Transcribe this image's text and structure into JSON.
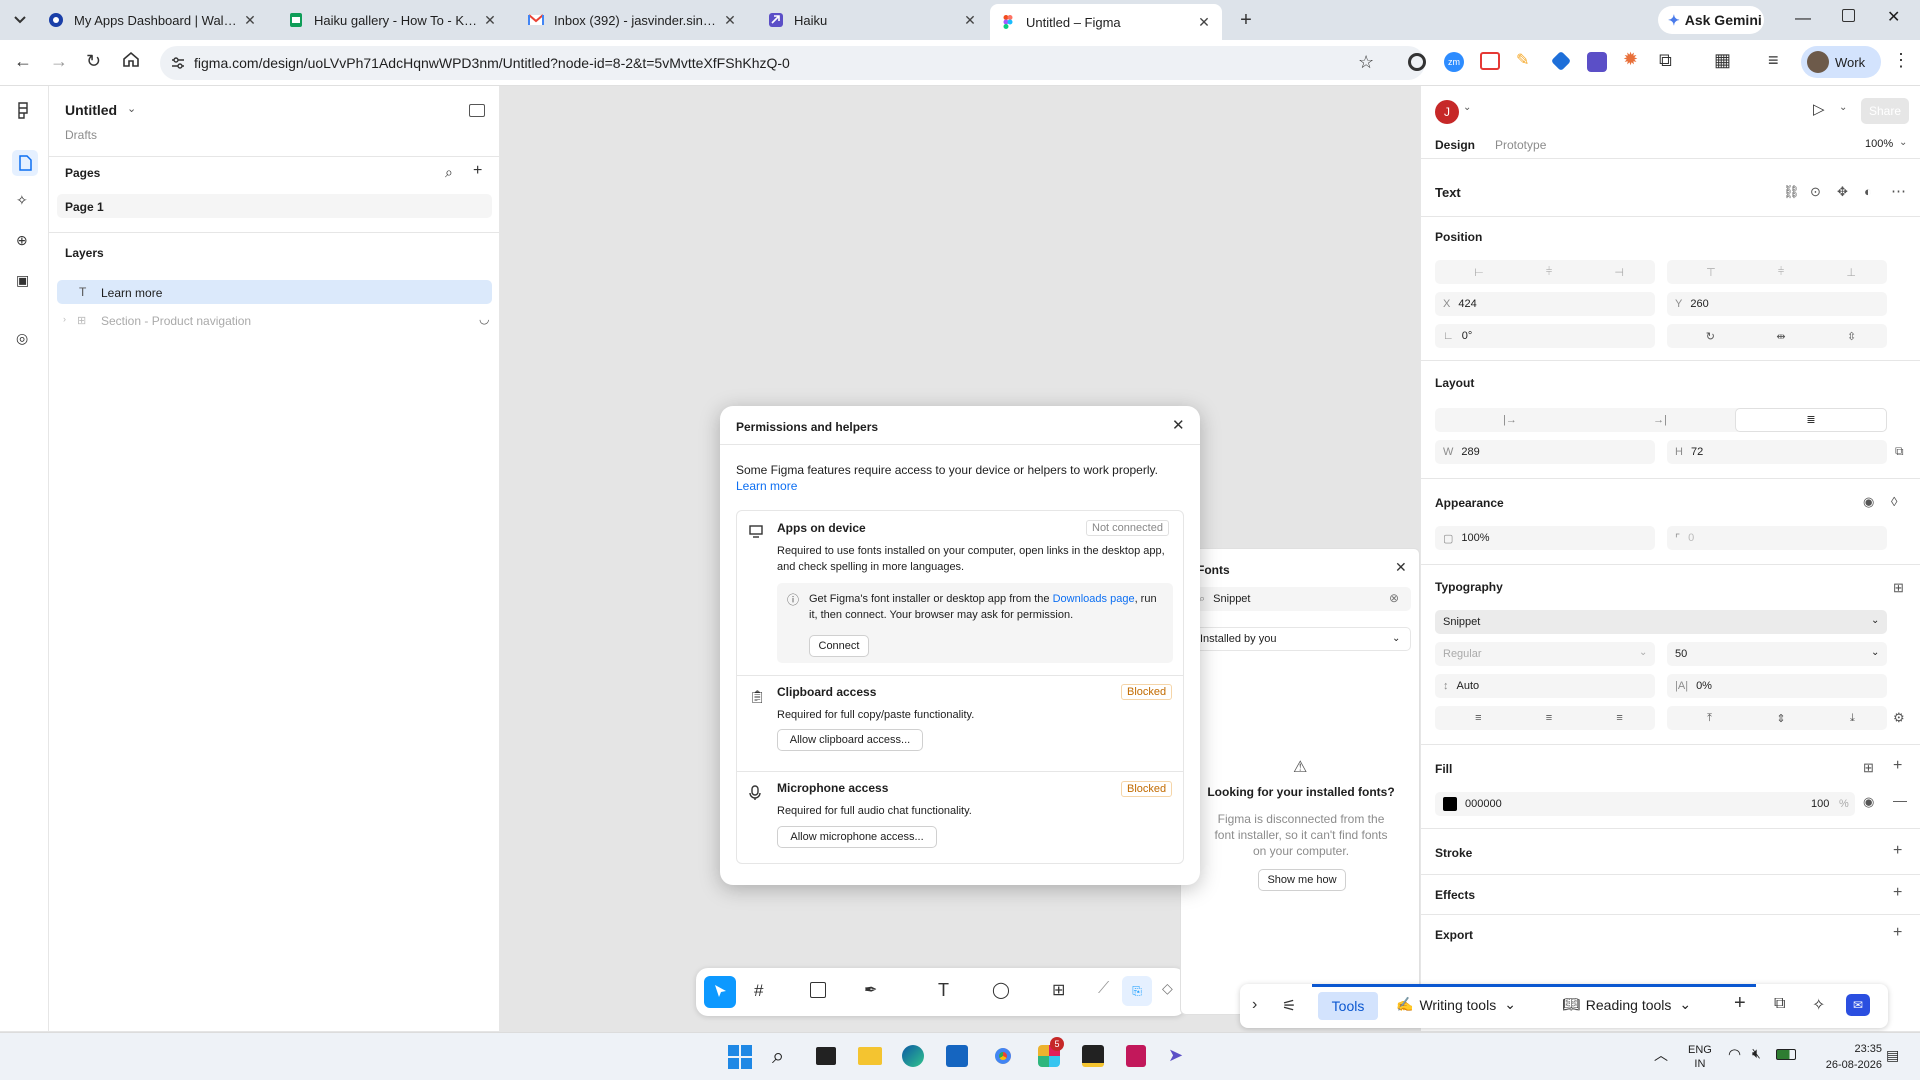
{
  "browser": {
    "tabs": [
      {
        "title": "My Apps Dashboard | WalkMe",
        "icon": "walkme-icon"
      },
      {
        "title": "Haiku gallery - How To - Keywo",
        "icon": "sheets-icon"
      },
      {
        "title": "Inbox (392) - jasvinder.singh@v",
        "icon": "gmail-icon"
      },
      {
        "title": "Haiku",
        "icon": "haiku-icon"
      },
      {
        "title": "Untitled – Figma",
        "icon": "figma-icon"
      }
    ],
    "ask_gemini": "Ask Gemini",
    "url": "figma.com/design/uoLVvPh71AdcHqnwWPD3nm/Untitled?node-id=8-2&t=5vMvtteXfFShKhzQ-0",
    "profile": "Work"
  },
  "left_panel": {
    "file_name": "Untitled",
    "location": "Drafts",
    "pages_heading": "Pages",
    "pages": [
      "Page 1"
    ],
    "layers_heading": "Layers",
    "layers": [
      "Learn more",
      "Section - Product navigation"
    ]
  },
  "right_panel": {
    "avatar": "J",
    "share": "Share",
    "tabs": [
      "Design",
      "Prototype"
    ],
    "zoom": "100%",
    "selection_type": "Text",
    "position_heading": "Position",
    "x_label": "X",
    "x": "424",
    "y_label": "Y",
    "y": "260",
    "rotation": "0°",
    "layout_heading": "Layout",
    "w_label": "W",
    "w": "289",
    "h_label": "H",
    "h": "72",
    "appearance_heading": "Appearance",
    "opacity": "100%",
    "radius": "0",
    "typography_heading": "Typography",
    "font": "Snippet",
    "weight": "Regular",
    "size": "50",
    "line_height": "Auto",
    "letter_spacing": "0%",
    "fill_heading": "Fill",
    "fill_hex": "000000",
    "fill_opacity": "100",
    "fill_pct": "%",
    "fill_color": "#000000",
    "stroke_heading": "Stroke",
    "effects_heading": "Effects",
    "export_heading": "Export"
  },
  "dialog": {
    "title": "Permissions and helpers",
    "intro": "Some Figma features require access to your device or helpers to work properly.",
    "learn_more": "Learn more",
    "apps": {
      "title": "Apps on device",
      "status": "Not connected",
      "desc": "Required to use fonts installed on your computer, open links in the desktop app, and check spelling in more languages.",
      "info_pre": "Get Figma's font installer or desktop app from the ",
      "info_link": "Downloads page",
      "info_post": ", run it, then connect. Your browser may ask for permission.",
      "button": "Connect"
    },
    "clipboard": {
      "title": "Clipboard access",
      "status": "Blocked",
      "desc": "Required for full copy/paste functionality.",
      "button": "Allow clipboard access..."
    },
    "microphone": {
      "title": "Microphone access",
      "status": "Blocked",
      "desc": "Required for full audio chat functionality.",
      "button": "Allow microphone access..."
    }
  },
  "fonts_panel": {
    "title": "Fonts",
    "search": "Snippet",
    "filter": "Installed by you",
    "heading": "Looking for your installed fonts?",
    "body": "Figma is disconnected from the font installer, so it can't find fonts on your computer.",
    "button": "Show me how"
  },
  "edge_toolbar": {
    "tools": "Tools",
    "writing_tools": "Writing tools",
    "reading_tools": "Reading tools"
  },
  "taskbar": {
    "lang1": "ENG",
    "lang2": "IN",
    "time": "23:35",
    "date": "26-08-2026",
    "slack_badge": "5"
  }
}
